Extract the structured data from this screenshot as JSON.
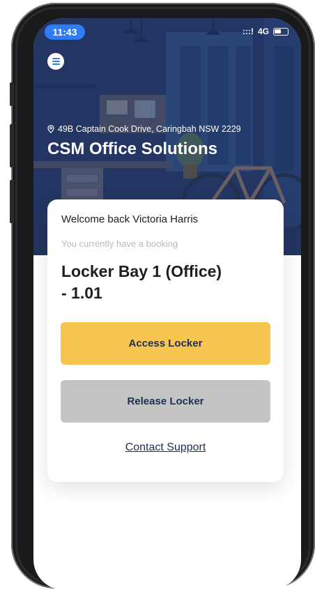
{
  "status_bar": {
    "time": "11:43",
    "signal": ":::!",
    "network": "4G"
  },
  "header": {
    "address": "49B Captain Cook Drive, Caringbah NSW 2229",
    "title": "CSM Office Solutions"
  },
  "card": {
    "welcome": "Welcome back Victoria Harris",
    "subtitle": "You currently have a booking",
    "locker_line1": "Locker Bay 1 (Office)",
    "locker_line2": "- 1.01",
    "access_label": "Access Locker",
    "release_label": "Release Locker",
    "support_label": "Contact Support"
  },
  "colors": {
    "accent_blue": "#2f7cf6",
    "access_button": "#f7c651",
    "release_button": "#c4c4c4",
    "button_text": "#1d2f55"
  }
}
